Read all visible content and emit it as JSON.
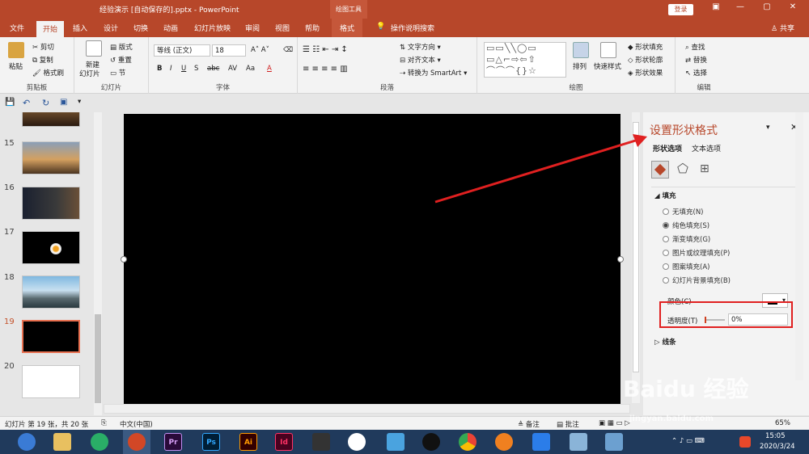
{
  "titlebar": {
    "doc": "经验演示 [自动保存的].pptx  -  PowerPoint",
    "context": "绘图工具",
    "login": "登录",
    "minimize": "—",
    "restore": "▢",
    "close": "✕"
  },
  "tabs": {
    "file": "文件",
    "home": "开始",
    "insert": "插入",
    "design": "设计",
    "transitions": "切换",
    "animations": "动画",
    "slideshow": "幻灯片放映",
    "review": "审阅",
    "view": "视图",
    "help": "帮助",
    "format": "格式",
    "search": "操作说明搜索",
    "share": "共享"
  },
  "ribbon": {
    "clipboard": {
      "paste": "粘贴",
      "cut": "剪切",
      "copy": "复制",
      "painter": "格式刷",
      "label": "剪贴板"
    },
    "slides": {
      "new": "新建",
      "new2": "幻灯片",
      "layout": "版式",
      "reset": "重置",
      "section": "节",
      "label": "幻灯片"
    },
    "font": {
      "family": "等线 (正文)",
      "size": "18",
      "label": "字体",
      "bold": "B",
      "italic": "I",
      "underline": "U",
      "strike": "S",
      "shadow": "abc",
      "spacing": "AV",
      "case": "Aa",
      "color": "A"
    },
    "paragraph": {
      "textdir": "文字方向",
      "align": "对齐文本",
      "smartart": "转换为 SmartArt",
      "label": "段落"
    },
    "drawing": {
      "arrange": "排列",
      "quickstyles": "快速样式",
      "fill": "形状填充",
      "outline": "形状轮廓",
      "effects": "形状效果",
      "label": "绘图",
      "shapes": "▭▭╲╲◯▭ ▭△⌐⇨⇦⇧ ⌒⌒⌒{}☆"
    },
    "editing": {
      "find": "查找",
      "replace": "替换",
      "select": "选择",
      "label": "编辑"
    }
  },
  "thumbs": [
    {
      "n": "15"
    },
    {
      "n": "16"
    },
    {
      "n": "17"
    },
    {
      "n": "18"
    },
    {
      "n": "19"
    },
    {
      "n": "20"
    }
  ],
  "pane": {
    "title": "设置形状格式",
    "tab_shape": "形状选项",
    "tab_text": "文本选项",
    "fill": "填充",
    "no_fill": "无填充(N)",
    "solid": "纯色填充(S)",
    "gradient": "渐变填充(G)",
    "picture": "图片或纹理填充(P)",
    "pattern": "图案填充(A)",
    "background": "幻灯片背景填充(B)",
    "color": "颜色(C)",
    "transparency": "透明度(T)",
    "transparency_value": "0%",
    "line": "线条"
  },
  "status": {
    "slide": "幻灯片 第 19 张，共 20 张",
    "lang": "中文(中国)",
    "notes": "备注",
    "comments": "批注",
    "zoom": "65%"
  },
  "taskbar": {
    "time": "15:05",
    "date": "2020/3/24",
    "apps": [
      "Pr",
      "Ps",
      "Ai",
      "Id"
    ]
  },
  "watermark": {
    "brand": "Baidu 经验",
    "url": "jingyan.baidu.com"
  },
  "colors": {
    "accent": "#b7472a",
    "annotation": "#e02020"
  }
}
